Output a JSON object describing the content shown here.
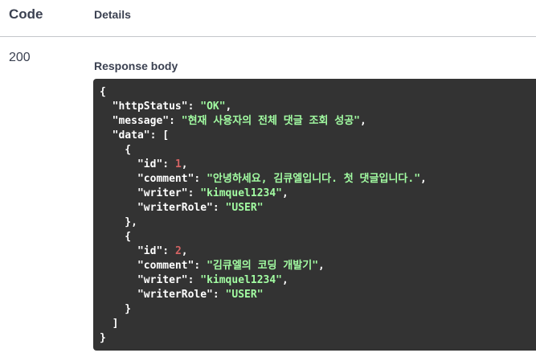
{
  "header": {
    "code_label": "Code",
    "details_label": "Details"
  },
  "response": {
    "status_code": "200",
    "body_label": "Response body"
  },
  "body": {
    "httpStatus": "OK",
    "message": "현재 사용자의 전체 댓글 조회 성공",
    "data": [
      {
        "id": "1",
        "comment": "안녕하세요, 김큐엘입니다. 첫 댓글입니다.",
        "writer": "kimquel1234",
        "writerRole": "USER"
      },
      {
        "id": "2",
        "comment": "김큐엘의 코딩 개발기",
        "writer": "kimquel1234",
        "writerRole": "USER"
      }
    ]
  }
}
